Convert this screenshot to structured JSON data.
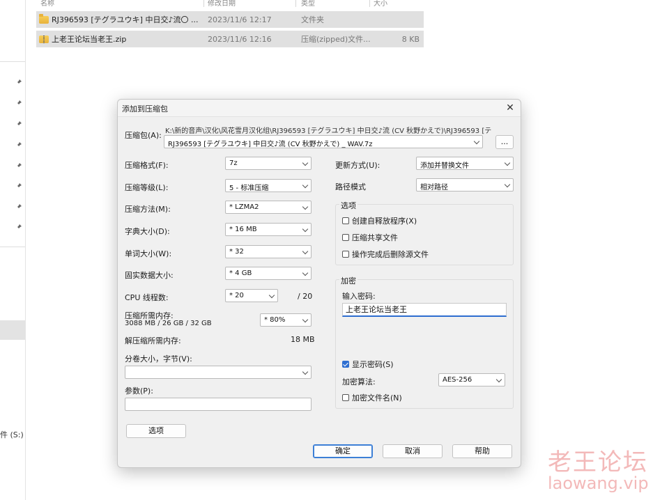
{
  "explorer": {
    "columns": [
      "名称",
      "修改日期",
      "类型",
      "大小"
    ],
    "files": [
      {
        "name": "RJ396593 [テグラユウキ] 中日交♪流〇 ...",
        "date": "2023/11/6 12:17",
        "type": "文件夹",
        "size": "",
        "icon": "folder-icon"
      },
      {
        "name": "上老王论坛当老王.zip",
        "date": "2023/11/6 12:16",
        "type": "压缩(zipped)文件...",
        "size": "8 KB",
        "icon": "zip-icon"
      }
    ],
    "drive_label": "件 (S:)"
  },
  "dialog": {
    "title": "添加到压缩包",
    "archive": {
      "label": "压缩包(A):",
      "path": "K:\\新的音声\\汉化\\风花雪月汉化组\\RJ396593 [テグラユウキ] 中日交♪流 (CV 秋野かえで)\\RJ396593 [テ",
      "filename": "RJ396593 [テグラユウキ] 中日交♪流 (CV 秋野かえで) _ WAV.7z",
      "browse": "..."
    },
    "left": {
      "format": {
        "label": "压缩格式(F):",
        "value": "7z"
      },
      "level": {
        "label": "压缩等级(L):",
        "value": "5 - 标准压缩"
      },
      "method": {
        "label": "压缩方法(M):",
        "value": "* LZMA2"
      },
      "dict": {
        "label": "字典大小(D):",
        "value": "* 16 MB"
      },
      "word": {
        "label": "单词大小(W):",
        "value": "* 32"
      },
      "solid": {
        "label": "固实数据大小:",
        "value": "* 4 GB"
      },
      "threads": {
        "label": "CPU 线程数:",
        "value": "* 20",
        "max": "/ 20"
      },
      "mem": {
        "label": "压缩所需内存:",
        "detail": "3088 MB / 26 GB / 32 GB",
        "value": "* 80%"
      },
      "decomp": {
        "label": "解压缩所需内存:",
        "value": "18 MB"
      },
      "split": {
        "label": "分卷大小，字节(V):",
        "value": ""
      },
      "params": {
        "label": "参数(P):",
        "value": ""
      },
      "options_button": "选项"
    },
    "right": {
      "update": {
        "label": "更新方式(U):",
        "value": "添加并替换文件"
      },
      "path_mode": {
        "label": "路径模式",
        "value": "相对路径"
      },
      "options_group": {
        "title": "选项",
        "sfx": {
          "label": "创建自释放程序(X)",
          "checked": false
        },
        "shared": {
          "label": "压缩共享文件",
          "checked": false
        },
        "delete": {
          "label": "操作完成后删除源文件",
          "checked": false
        }
      },
      "encryption": {
        "title": "加密",
        "pwd_label": "输入密码:",
        "password": "上老王论坛当老王",
        "show_pwd": {
          "label": "显示密码(S)",
          "checked": true
        },
        "method_label": "加密算法:",
        "method_value": "AES-256",
        "encrypt_names": {
          "label": "加密文件名(N)",
          "checked": false
        }
      }
    },
    "buttons": {
      "ok": "确定",
      "cancel": "取消",
      "help": "帮助"
    }
  },
  "watermark": {
    "cn": "老王论坛",
    "en": "laowang.vip"
  },
  "colors": {
    "accent": "#2c6dd0",
    "watermark": "#f3b9b9",
    "folder": "#f6cd58"
  }
}
